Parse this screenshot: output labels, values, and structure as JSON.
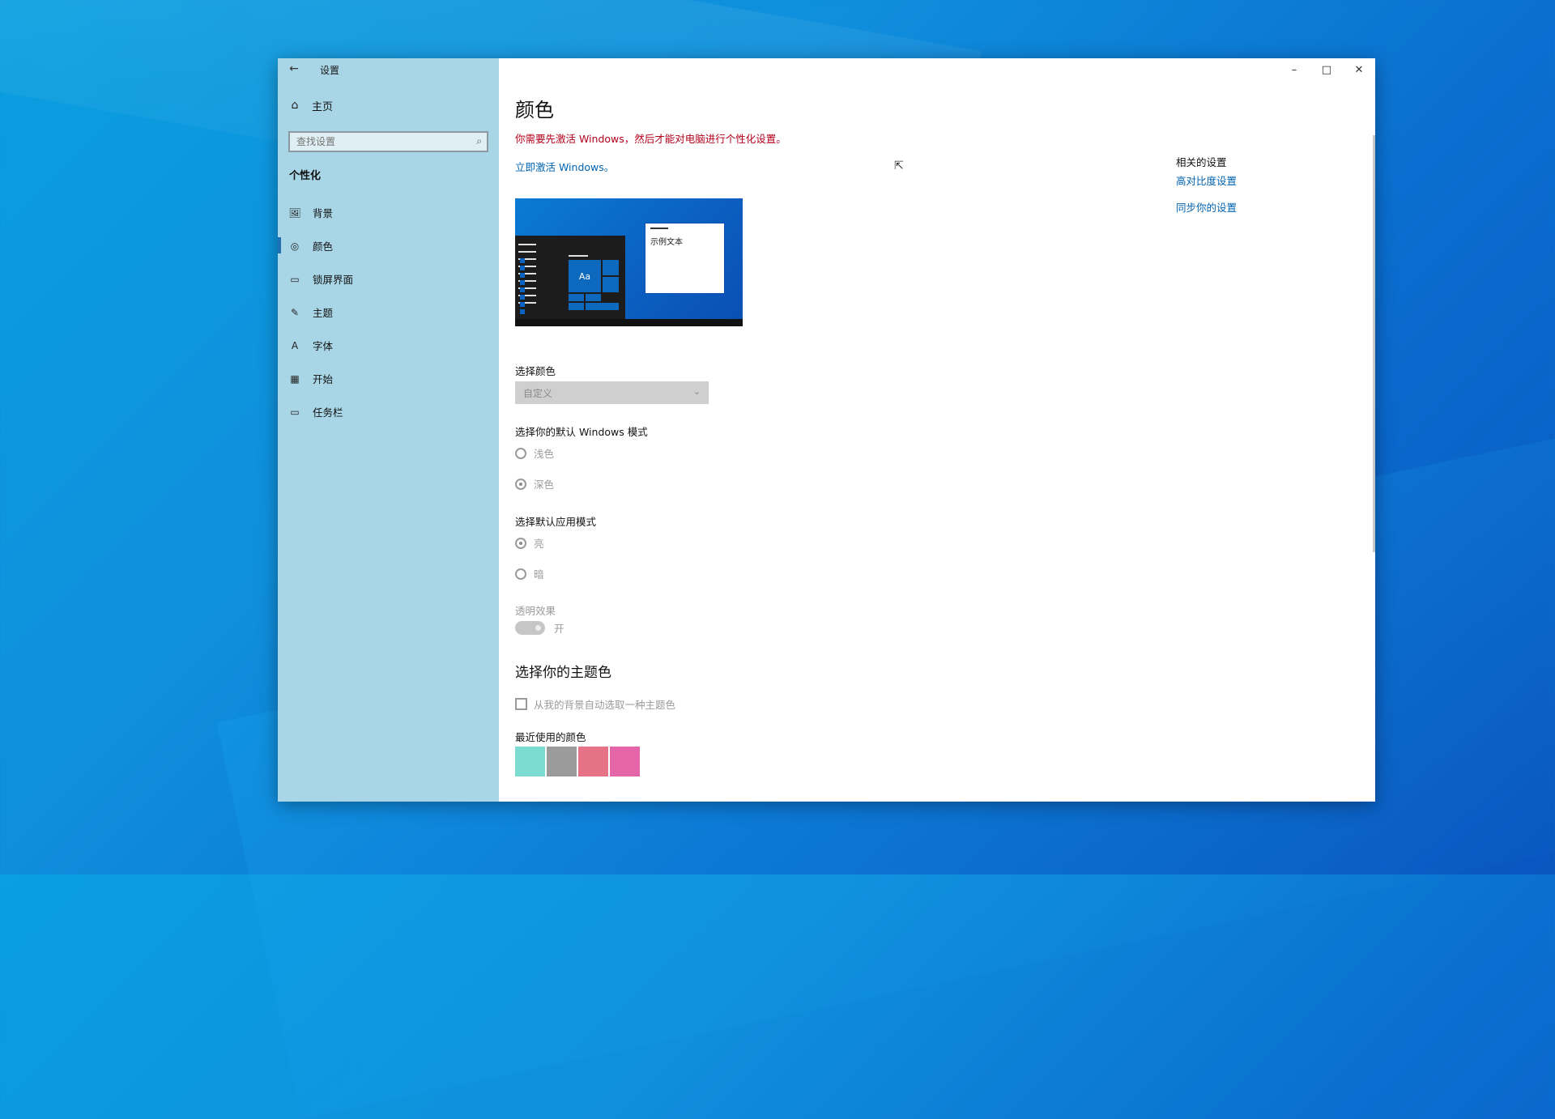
{
  "window": {
    "title": "设置",
    "controls": {
      "minimize": "–",
      "maximize": "□",
      "close": "✕"
    }
  },
  "sidebar": {
    "home_label": "主页",
    "search_placeholder": "查找设置",
    "section_title": "个性化",
    "items": [
      {
        "label": "背景",
        "icon": "image-icon",
        "glyph": "🖼"
      },
      {
        "label": "颜色",
        "icon": "palette-icon",
        "glyph": "◎",
        "active": true
      },
      {
        "label": "锁屏界面",
        "icon": "lock-screen-icon",
        "glyph": "▭"
      },
      {
        "label": "主题",
        "icon": "theme-icon",
        "glyph": "✎"
      },
      {
        "label": "字体",
        "icon": "font-icon",
        "glyph": "A"
      },
      {
        "label": "开始",
        "icon": "start-icon",
        "glyph": "▦"
      },
      {
        "label": "任务栏",
        "icon": "taskbar-icon",
        "glyph": "▭"
      }
    ]
  },
  "main": {
    "title": "颜色",
    "activation_warning": "你需要先激活 Windows，然后才能对电脑进行个性化设置。",
    "activate_link": "立即激活 Windows。",
    "preview": {
      "sample_text": "示例文本",
      "tile_label": "Aa"
    },
    "choose_color": {
      "label": "选择颜色",
      "value": "自定义"
    },
    "windows_mode": {
      "label": "选择你的默认 Windows 模式",
      "options": [
        {
          "label": "浅色",
          "selected": false
        },
        {
          "label": "深色",
          "selected": true
        }
      ]
    },
    "app_mode": {
      "label": "选择默认应用模式",
      "options": [
        {
          "label": "亮",
          "selected": true
        },
        {
          "label": "暗",
          "selected": false
        }
      ]
    },
    "transparency": {
      "label": "透明效果",
      "state": "开",
      "on": true
    },
    "accent": {
      "heading": "选择你的主题色",
      "auto_pick_label": "从我的背景自动选取一种主题色",
      "auto_pick_checked": false,
      "recent_label": "最近使用的颜色",
      "recent_colors": [
        "#7ddcd1",
        "#9b9b9b",
        "#e57286",
        "#e465a8"
      ]
    }
  },
  "related": {
    "title": "相关的设置",
    "links": [
      "高对比度设置",
      "同步你的设置"
    ]
  }
}
